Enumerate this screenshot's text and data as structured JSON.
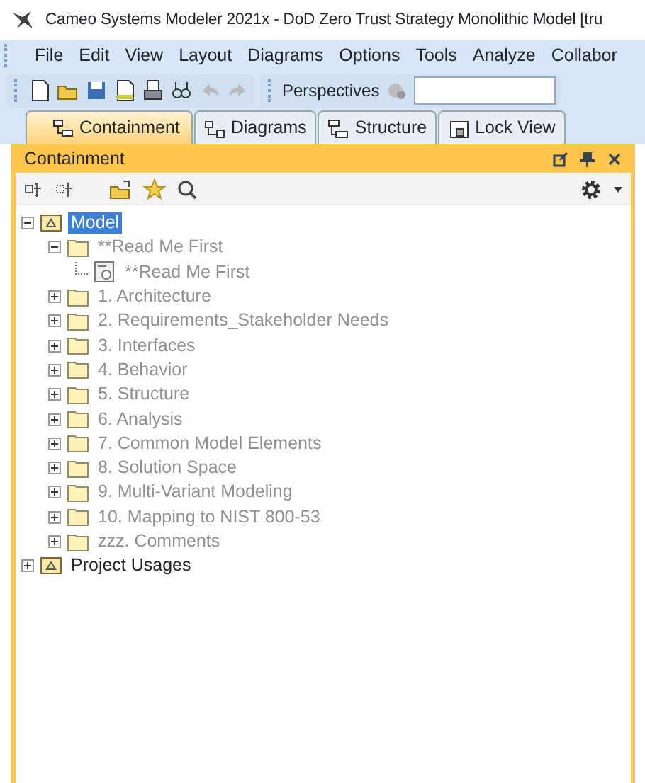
{
  "window": {
    "title": "Cameo Systems Modeler 2021x - DoD Zero Trust Strategy Monolithic Model [tru"
  },
  "menu": [
    "File",
    "Edit",
    "View",
    "Layout",
    "Diagrams",
    "Options",
    "Tools",
    "Analyze",
    "Collabor"
  ],
  "toolbar": {
    "perspectives": "Perspectives"
  },
  "tabs": [
    {
      "label": "Containment",
      "selected": true,
      "kind": "containment"
    },
    {
      "label": "Diagrams",
      "selected": false,
      "kind": "diagrams"
    },
    {
      "label": "Structure",
      "selected": false,
      "kind": "structure"
    },
    {
      "label": "Lock View",
      "selected": false,
      "kind": "lock"
    }
  ],
  "panel": {
    "title": "Containment"
  },
  "tree": [
    {
      "label": "Model",
      "kind": "model",
      "expanded": true,
      "selected": true,
      "greyed": false,
      "children": [
        {
          "label": "**Read Me First",
          "kind": "folder",
          "expanded": true,
          "selected": false,
          "greyed": true,
          "children": [
            {
              "label": "**Read Me First",
              "kind": "diagram",
              "selected": false,
              "greyed": true
            }
          ]
        },
        {
          "label": "1. Architecture",
          "kind": "folder",
          "expanded": false,
          "selected": false,
          "greyed": true
        },
        {
          "label": "2. Requirements_Stakeholder Needs",
          "kind": "folder",
          "expanded": false,
          "selected": false,
          "greyed": true
        },
        {
          "label": "3. Interfaces",
          "kind": "folder",
          "expanded": false,
          "selected": false,
          "greyed": true
        },
        {
          "label": "4. Behavior",
          "kind": "folder",
          "expanded": false,
          "selected": false,
          "greyed": true
        },
        {
          "label": "5. Structure",
          "kind": "folder",
          "expanded": false,
          "selected": false,
          "greyed": true
        },
        {
          "label": "6. Analysis",
          "kind": "folder",
          "expanded": false,
          "selected": false,
          "greyed": true
        },
        {
          "label": "7. Common Model Elements",
          "kind": "folder",
          "expanded": false,
          "selected": false,
          "greyed": true
        },
        {
          "label": "8. Solution Space",
          "kind": "folder",
          "expanded": false,
          "selected": false,
          "greyed": true
        },
        {
          "label": "9. Multi-Variant Modeling",
          "kind": "folder",
          "expanded": false,
          "selected": false,
          "greyed": true
        },
        {
          "label": "10. Mapping to NIST 800-53",
          "kind": "folder",
          "expanded": false,
          "selected": false,
          "greyed": true
        },
        {
          "label": "zzz. Comments",
          "kind": "folder",
          "expanded": false,
          "selected": false,
          "greyed": true
        }
      ]
    },
    {
      "label": "Project Usages",
      "kind": "model",
      "expanded": false,
      "selected": false,
      "greyed": false
    }
  ]
}
